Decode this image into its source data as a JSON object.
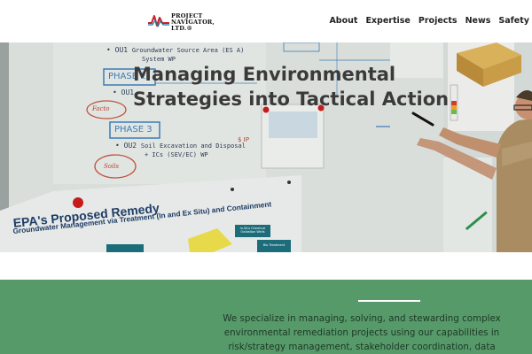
{
  "header": {
    "logo": {
      "line1": "PROJECT",
      "line2": "NAVIGATOR, LTD.",
      "tm": "®"
    },
    "nav": [
      "About",
      "Expertise",
      "Projects",
      "News",
      "Safety"
    ]
  },
  "hero": {
    "title_line1": "Managing Environmental",
    "title_line2": "Strategies into Tactical Action",
    "board": {
      "phase2": "PHASE 2",
      "phase3": "PHASE 3",
      "ou1a": "• OU1",
      "ou1a_note": "Groundwater Source Area (ES A)",
      "ou1a_note2": "System WP",
      "ou1b": "• OU1",
      "ou2": "• OU2",
      "ou2_note": "Soil Excavation and Disposal",
      "ou2_note2": "+ ICs (SEV/EC) WP",
      "circle1": "Facto",
      "circle2": "Soils",
      "cost": "$ IP",
      "poster_title": "EPA's Proposed Remedy",
      "poster_sub": "Groundwater Management via Treatment (In and Ex Situ) and Containment",
      "poster_box1": "In-Situ Chemical Oxidation Wells",
      "poster_box2": "Bio Treatment"
    }
  },
  "band": {
    "text_line1": "We specialize in managing, solving, and stewarding complex",
    "text_line2": "environmental remediation projects using our capabilities in",
    "text_line3": "risk/strategy management, stakeholder coordination, data"
  }
}
